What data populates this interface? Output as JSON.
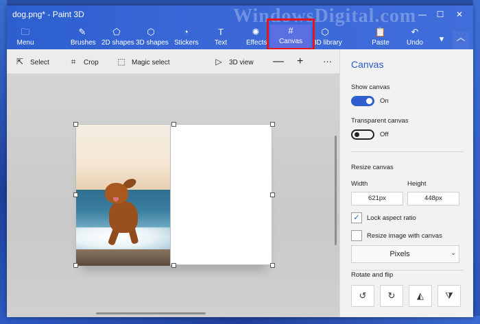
{
  "window": {
    "title": "dog.png* - Paint 3D",
    "watermark": "WindowsDigital.com"
  },
  "window_controls": {
    "minimize": "—",
    "maximize": "☐",
    "close": "✕"
  },
  "ribbon": {
    "menu": {
      "label": "Menu",
      "icon": "folder-icon",
      "glyph": "🗀"
    },
    "tools": [
      {
        "label": "Brushes",
        "icon": "brush-icon",
        "glyph": "✎"
      },
      {
        "label": "2D shapes",
        "icon": "2d-shapes-icon",
        "glyph": "⬠"
      },
      {
        "label": "3D shapes",
        "icon": "cube-icon",
        "glyph": "⬡"
      },
      {
        "label": "Stickers",
        "icon": "sticker-icon",
        "glyph": "◔"
      },
      {
        "label": "Text",
        "icon": "text-icon",
        "glyph": "T"
      },
      {
        "label": "Effects",
        "icon": "sun-icon",
        "glyph": "✺"
      },
      {
        "label": "Canvas",
        "icon": "canvas-grid-icon",
        "glyph": "#",
        "selected": true
      },
      {
        "label": "3D library",
        "icon": "3d-library-icon",
        "glyph": "⬡"
      },
      {
        "label": "Paste",
        "icon": "clipboard-icon",
        "glyph": "📋"
      },
      {
        "label": "Undo",
        "icon": "undo-icon",
        "glyph": "↶"
      }
    ],
    "more_glyph": "▾",
    "collapse_glyph": "︿",
    "highlight_color": "#e8141b"
  },
  "subbar": {
    "select": {
      "label": "Select",
      "glyph": "⇱"
    },
    "crop": {
      "label": "Crop",
      "glyph": "⌗"
    },
    "magic_select": {
      "label": "Magic select",
      "glyph": "⬚"
    },
    "view_3d": {
      "label": "3D view",
      "glyph": "▷"
    },
    "zoom_out": "—",
    "zoom_in": "+",
    "more": "···"
  },
  "panel": {
    "title": "Canvas",
    "show_canvas": {
      "label": "Show canvas",
      "state": "On"
    },
    "transparent_canvas": {
      "label": "Transparent canvas",
      "state": "Off"
    },
    "resize": {
      "heading": "Resize canvas",
      "width_label": "Width",
      "height_label": "Height",
      "width_value": "621px",
      "height_value": "448px"
    },
    "lock_aspect": {
      "label": "Lock aspect ratio",
      "checked": true,
      "mark": "✓"
    },
    "resize_image": {
      "label": "Resize image with canvas",
      "checked": false
    },
    "units": {
      "value": "Pixels",
      "chevron": "⌄"
    },
    "rotate_flip": {
      "heading": "Rotate and flip",
      "buttons": [
        {
          "icon": "rotate-left-icon",
          "glyph": "↺"
        },
        {
          "icon": "rotate-right-icon",
          "glyph": "↻"
        },
        {
          "icon": "flip-horizontal-icon",
          "glyph": "◭"
        },
        {
          "icon": "flip-vertical-icon",
          "glyph": "⧩"
        }
      ]
    }
  },
  "colors": {
    "accent": "#2d5fcf",
    "ribbon": "#3a67d6",
    "selected_tool": "#5b6ee2"
  }
}
